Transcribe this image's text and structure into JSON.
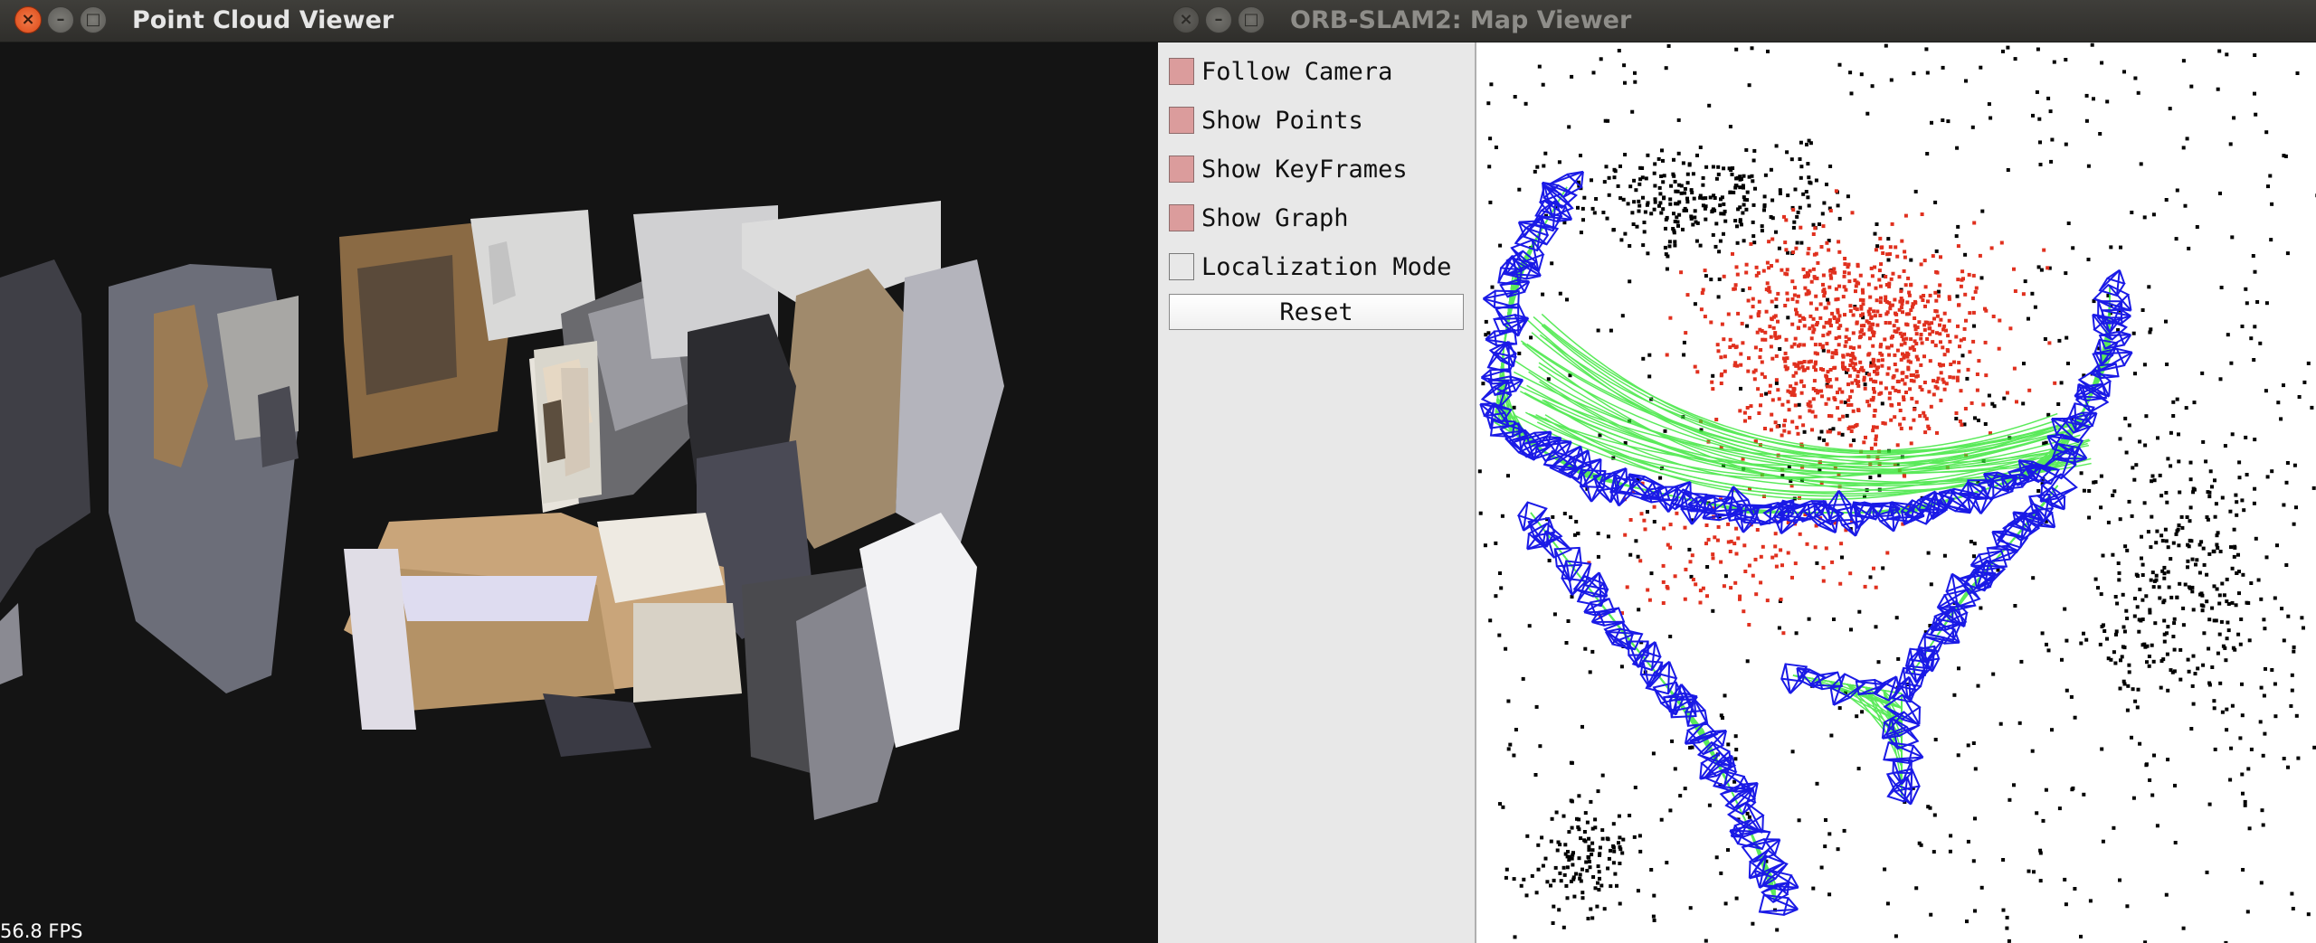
{
  "left_window": {
    "title": "Point Cloud Viewer",
    "fps": "56.8 FPS",
    "icons": {
      "close": "close-icon",
      "minimize": "minimize-icon",
      "maximize": "maximize-icon"
    }
  },
  "right_window": {
    "title": "ORB-SLAM2: Map Viewer",
    "options": [
      {
        "label": "Follow Camera",
        "checked": true
      },
      {
        "label": "Show Points",
        "checked": true
      },
      {
        "label": "Show KeyFrames",
        "checked": true
      },
      {
        "label": "Show Graph",
        "checked": true
      },
      {
        "label": "Localization Mode",
        "checked": false
      }
    ],
    "reset_label": "Reset",
    "icons": {
      "close": "close-icon",
      "minimize": "minimize-icon",
      "maximize": "maximize-icon"
    }
  },
  "colors": {
    "checked_box": "#db9c9c",
    "map_points_current": "#e0301e",
    "map_points": "#000000",
    "keyframes": "#1a1ae6",
    "covisibility_graph": "#33e633",
    "titlebar": "#3a3935"
  },
  "icon_glyphs": {
    "close": "×",
    "minimize": "–",
    "maximize": "□"
  }
}
